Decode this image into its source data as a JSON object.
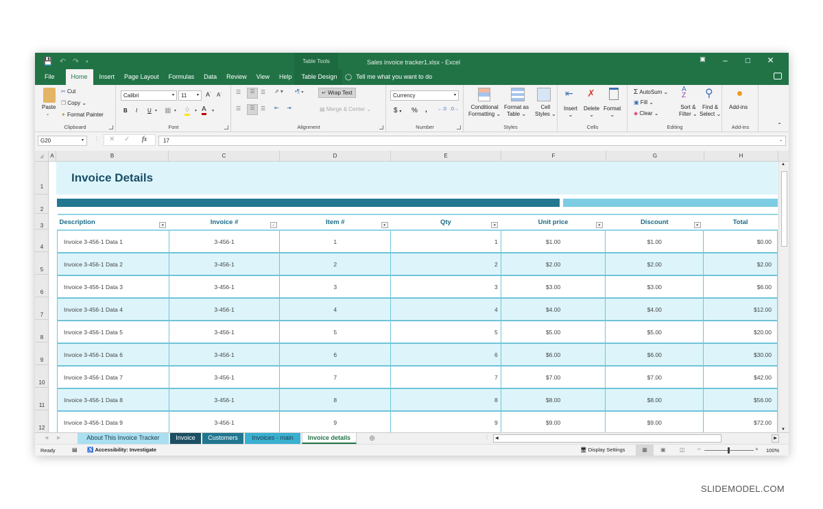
{
  "window": {
    "title": "Sales invoice tracker1.xlsx  -  Excel",
    "context_tab_group": "Table Tools",
    "controls": [
      "ribbon-display",
      "minimize",
      "maximize",
      "close"
    ]
  },
  "ribbon_tabs": [
    "File",
    "Home",
    "Insert",
    "Page Layout",
    "Formulas",
    "Data",
    "Review",
    "View",
    "Help",
    "Table Design"
  ],
  "active_tab": "Home",
  "tell_me": "Tell me what you want to do",
  "ribbon": {
    "clipboard": {
      "label": "Clipboard",
      "paste": "Paste",
      "cut": "Cut",
      "copy": "Copy",
      "format_painter": "Format Painter"
    },
    "font": {
      "label": "Font",
      "font_name": "Calibri",
      "font_size": "11",
      "bold": "B",
      "italic": "I",
      "underline": "U"
    },
    "alignment": {
      "label": "Alignment",
      "wrap_text": "Wrap Text",
      "merge_center": "Merge & Center"
    },
    "number": {
      "label": "Number",
      "format": "Currency",
      "currency": "$",
      "percent": "%",
      "comma": ","
    },
    "styles": {
      "label": "Styles",
      "conditional_1": "Conditional",
      "conditional_2": "Formatting",
      "format_table_1": "Format as",
      "format_table_2": "Table",
      "cell_styles_1": "Cell",
      "cell_styles_2": "Styles"
    },
    "cells": {
      "label": "Cells",
      "insert": "Insert",
      "delete": "Delete",
      "format": "Format"
    },
    "editing": {
      "label": "Editing",
      "autosum": "AutoSum",
      "fill": "Fill",
      "clear": "Clear",
      "sort_1": "Sort &",
      "sort_2": "Filter",
      "find_1": "Find &",
      "find_2": "Select"
    },
    "addins": {
      "label": "Add-ins",
      "button": "Add-ins"
    }
  },
  "formula_bar": {
    "name_box": "G20",
    "value": "17",
    "fx": "fx"
  },
  "columns": [
    "A",
    "B",
    "C",
    "D",
    "E",
    "F",
    "G",
    "H"
  ],
  "rows": [
    "1",
    "2",
    "3",
    "4",
    "5",
    "6",
    "7",
    "8",
    "9",
    "10",
    "11",
    "12"
  ],
  "sheet": {
    "title": "Invoice Details",
    "headers": [
      "Description",
      "Invoice #",
      "Item #",
      "Qty",
      "Unit price",
      "Discount",
      "Total"
    ],
    "data": [
      [
        "Invoice 3-456-1 Data 1",
        "3-456-1",
        "1",
        "1",
        "$1.00",
        "$1.00",
        "$0.00"
      ],
      [
        "Invoice 3-456-1 Data 2",
        "3-456-1",
        "2",
        "2",
        "$2.00",
        "$2.00",
        "$2.00"
      ],
      [
        "Invoice 3-456-1 Data 3",
        "3-456-1",
        "3",
        "3",
        "$3.00",
        "$3.00",
        "$6.00"
      ],
      [
        "Invoice 3-456-1 Data 4",
        "3-456-1",
        "4",
        "4",
        "$4.00",
        "$4.00",
        "$12.00"
      ],
      [
        "Invoice 3-456-1 Data 5",
        "3-456-1",
        "5",
        "5",
        "$5.00",
        "$5.00",
        "$20.00"
      ],
      [
        "Invoice 3-456-1 Data 6",
        "3-456-1",
        "6",
        "6",
        "$6.00",
        "$6.00",
        "$30.00"
      ],
      [
        "Invoice 3-456-1 Data 7",
        "3-456-1",
        "7",
        "7",
        "$7.00",
        "$7.00",
        "$42.00"
      ],
      [
        "Invoice 3-456-1 Data 8",
        "3-456-1",
        "8",
        "8",
        "$8.00",
        "$8.00",
        "$56.00"
      ],
      [
        "Invoice 3-456-1 Data 9",
        "3-456-1",
        "9",
        "9",
        "$9.00",
        "$9.00",
        "$72.00"
      ]
    ]
  },
  "sheet_tabs": [
    {
      "label": "About This Invoice Tracker",
      "bg": "#a9dff0",
      "fg": "#1c3b4a"
    },
    {
      "label": "Invoice",
      "bg": "#1c4f63",
      "fg": "#ffffff"
    },
    {
      "label": "Customers",
      "bg": "#217790",
      "fg": "#ffffff"
    },
    {
      "label": "Invoices - main",
      "bg": "#3ab0d0",
      "fg": "#1c3b4a"
    },
    {
      "label": "Invoice details",
      "bg": "#ffffff",
      "fg": "#217346",
      "active": true
    }
  ],
  "status": {
    "ready": "Ready",
    "accessibility": "Accessibility: Investigate",
    "display_settings": "Display Settings",
    "zoom": "100%"
  },
  "colors": {
    "excel_green": "#217346",
    "title_text": "#1a4e66",
    "band_dark": "#217790",
    "band_light": "#7dcde2",
    "row_alt": "#ddf5fa",
    "header_text": "#1b6b86"
  },
  "watermark": "SLIDEMODEL.COM"
}
